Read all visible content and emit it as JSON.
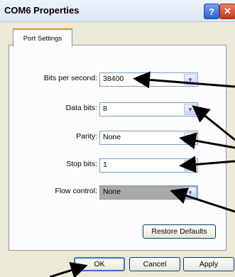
{
  "window": {
    "title": "COM6 Properties"
  },
  "titlebar": {
    "help_label": "?",
    "close_label": "✕"
  },
  "tabs": [
    {
      "label": "Port Settings"
    }
  ],
  "fields": [
    {
      "label": "Bits per second:",
      "value": "38400"
    },
    {
      "label": "Data bits:",
      "value": "8"
    },
    {
      "label": "Parity:",
      "value": "None"
    },
    {
      "label": "Stop bits:",
      "value": "1"
    },
    {
      "label": "Flow control:",
      "value": "None"
    }
  ],
  "buttons": {
    "restore_defaults": "Restore Defaults",
    "ok": "OK",
    "cancel": "Cancel",
    "apply": "Apply"
  },
  "icons": {
    "dropdown": "chevron-down-icon"
  }
}
